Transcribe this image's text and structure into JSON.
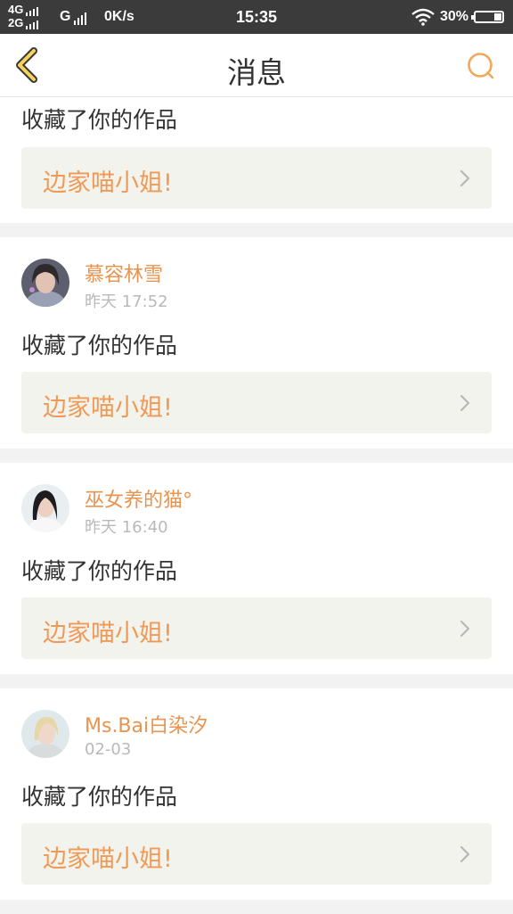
{
  "status_bar": {
    "net1": "4G",
    "net2": "2G",
    "net3": "G",
    "speed": "0K/s",
    "time": "15:35",
    "battery": "30%",
    "battery_level": 0.3
  },
  "nav": {
    "title": "消息",
    "back_icon": "chevron-left-icon",
    "search_icon": "search-icon",
    "accent_color": "#f0a95a"
  },
  "feed": {
    "first": {
      "action": "收藏了你的作品",
      "work_title": "边家喵小姐!"
    },
    "items": [
      {
        "name": "慕容林雪",
        "time": "昨天 17:52",
        "action": "收藏了你的作品",
        "work_title": "边家喵小姐!"
      },
      {
        "name": "巫女养的猫°",
        "time": "昨天 16:40",
        "action": "收藏了你的作品",
        "work_title": "边家喵小姐!"
      },
      {
        "name": "Ms.Bai白染汐",
        "time": "02-03",
        "action": "收藏了你的作品",
        "work_title": "边家喵小姐!"
      }
    ]
  }
}
